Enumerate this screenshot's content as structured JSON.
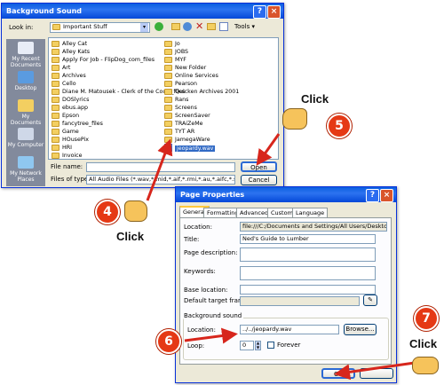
{
  "background_sound": {
    "title": "Background Sound",
    "look_in_label": "Look in:",
    "look_in_value": "Important Stuff",
    "tools_label": "Tools ▾",
    "places": [
      "My Recent Documents",
      "Desktop",
      "My Documents",
      "My Computer",
      "My Network Places"
    ],
    "files_col1": [
      "Alley Cat",
      "Alley Kats",
      "Apply For Job - FlipDog_com_files",
      "Art",
      "Archives",
      "Cello",
      "Diane M. Matousek - Clerk of the Court_files",
      "DOSlyrics",
      "ebus.app",
      "Epson",
      "fancytree_files",
      "Game",
      "HOusePix",
      "HRI",
      "Invoice"
    ],
    "files_col2": [
      "Jo",
      "JOBS",
      "MYF",
      "New Folder",
      "Online Services",
      "Pearson",
      "Quicken Archives 2001",
      "Rans",
      "Screens",
      "ScreenSaver",
      "TRAiZeMe",
      "TYT AR",
      "JamegaWare",
      "jeopardy.wav"
    ],
    "file_name_label": "File name:",
    "file_name_value": "",
    "files_of_type_label": "Files of type:",
    "files_of_type_value": "All Audio Files (*.wav,*.mid,*.aif,*.rmi,*.au,*.aifc,*.snd,*.mp3 ▾",
    "open_label": "Open",
    "cancel_label": "Cancel"
  },
  "page_properties": {
    "title": "Page Properties",
    "tabs": [
      "General",
      "Formatting",
      "Advanced",
      "Custom",
      "Language"
    ],
    "location_label": "Location:",
    "location_value": "file:///C:/Documents and Settings/All Users/Desktop/Import",
    "title_label": "Title:",
    "title_value": "Ned's Guide to Lumber",
    "page_description_label": "Page description:",
    "keywords_label": "Keywords:",
    "base_location_label": "Base location:",
    "default_target_frame_label": "Default target frame:",
    "background_sound_label": "Background sound",
    "bg_location_label": "Location:",
    "bg_location_value": "../../jeopardy.wav",
    "browse_label": "Browse...",
    "loop_label": "Loop:",
    "loop_value": "0",
    "forever_label": "Forever",
    "ok_label": "OK"
  },
  "callouts": {
    "step4": "4",
    "step5": "5",
    "step6": "6",
    "step7": "7",
    "click": "Click"
  },
  "colors": {
    "titlebar": "#0a5ee0",
    "dialog_face": "#ece9d8",
    "badge": "#e53915",
    "arrow": "#d7261c"
  }
}
